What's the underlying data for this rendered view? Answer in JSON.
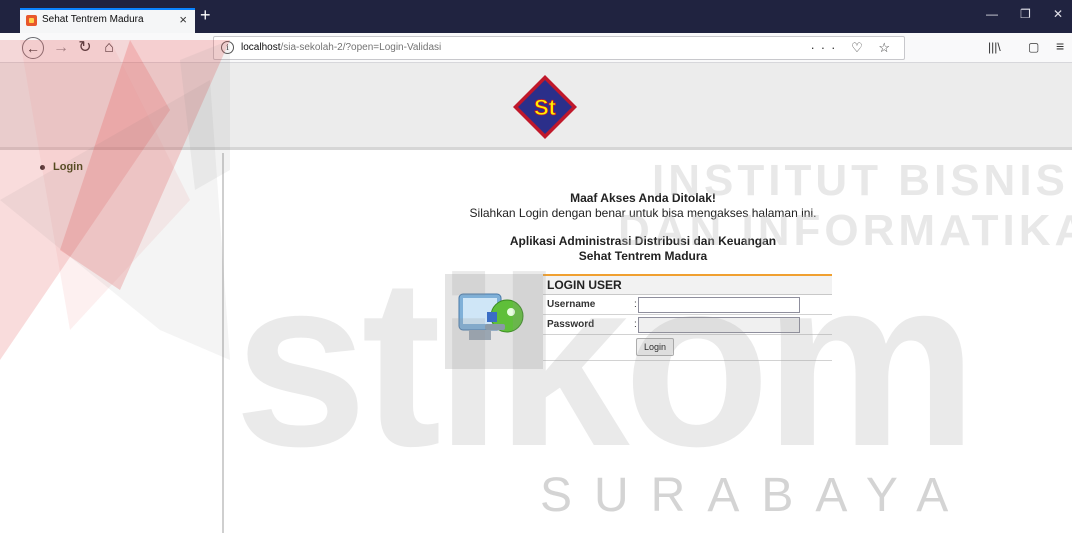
{
  "browser": {
    "tab": {
      "title": "Sehat Tentrem Madura",
      "close": "×"
    },
    "new_tab": "+",
    "window_controls": {
      "minimize": "—",
      "restore": "❐",
      "close": "✕"
    },
    "nav": {
      "back": "←",
      "forward": "→",
      "reload": "↻",
      "home": "⌂"
    },
    "url": {
      "host": "localhost",
      "path": "/sia-sekolah-2/?open=Login-Validasi"
    },
    "url_actions": "··· ♡ ☆",
    "tools": {
      "library": "|||\\",
      "sidebar": "▢",
      "menu": "≡"
    }
  },
  "logo": {
    "text": "St",
    "color": "#fff200",
    "bg": "#2b2f8a",
    "border": "#c0182b"
  },
  "sidebar": {
    "items": [
      {
        "label": "Login"
      }
    ]
  },
  "message": {
    "title": "Maaf Akses Anda Ditolak!",
    "subtitle": "Silahkan Login dengan benar untuk bisa mengakses halaman ini."
  },
  "app": {
    "title": "Aplikasi Administrasi Distribusi dan Keuangan",
    "subtitle": "Sehat Tentrem Madura"
  },
  "login": {
    "heading": "LOGIN USER",
    "username_label": "Username",
    "password_label": "Password",
    "colon": ":",
    "username_value": "",
    "password_value": "",
    "button": "Login"
  },
  "watermark": {
    "line1": "INSTITUT BISNIS",
    "line2": "DAN INFORMATIKA",
    "brand": "stikom",
    "city": "SURABAYA"
  }
}
